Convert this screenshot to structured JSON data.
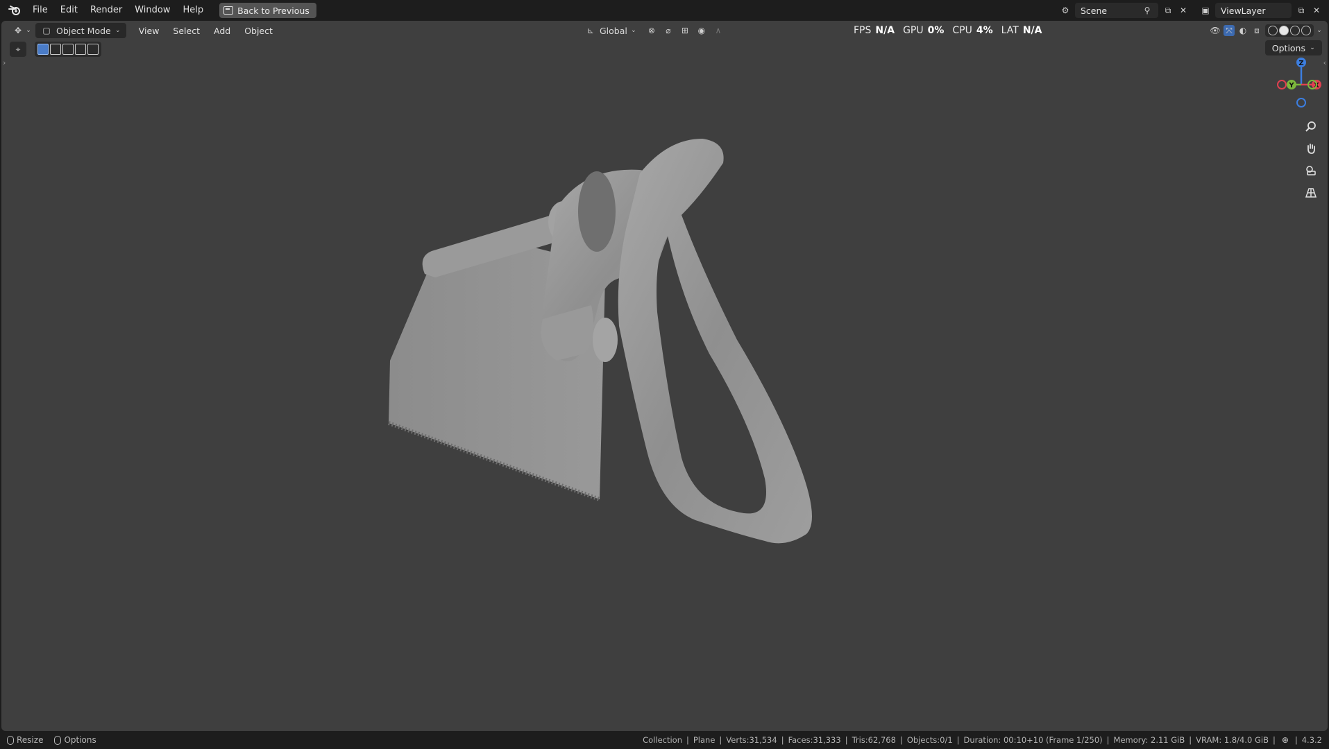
{
  "topbar": {
    "menus": [
      "File",
      "Edit",
      "Render",
      "Window",
      "Help"
    ],
    "back_button": "Back to Previous",
    "scene_label": "Scene",
    "viewlayer_label": "ViewLayer"
  },
  "viewport": {
    "mode": "Object Mode",
    "menus": [
      "View",
      "Select",
      "Add",
      "Object"
    ],
    "orientation": "Global",
    "options_label": "Options",
    "stats": {
      "fps_label": "FPS",
      "fps_value": "N/A",
      "gpu_label": "GPU",
      "gpu_value": "0%",
      "cpu_label": "CPU",
      "cpu_value": "4%",
      "lat_label": "LAT",
      "lat_value": "N/A"
    },
    "gizmo": {
      "z": "Z",
      "y": "Y",
      "x": "X"
    },
    "colors": {
      "background": "#3f3f3f",
      "x_axis": "#e04050",
      "y_axis": "#7cb83c",
      "z_axis": "#3c7ee0",
      "model": "#9a9a9a"
    }
  },
  "statusbar": {
    "left": [
      "Resize",
      "Options"
    ],
    "collection": "Collection",
    "object": "Plane",
    "verts": "Verts:31,534",
    "faces": "Faces:31,333",
    "tris": "Tris:62,768",
    "objects": "Objects:0/1",
    "duration": "Duration: 00:10+10 (Frame 1/250)",
    "memory": "Memory: 2.11 GiB",
    "vram": "VRAM: 1.8/4.0 GiB",
    "version": "4.3.2"
  }
}
